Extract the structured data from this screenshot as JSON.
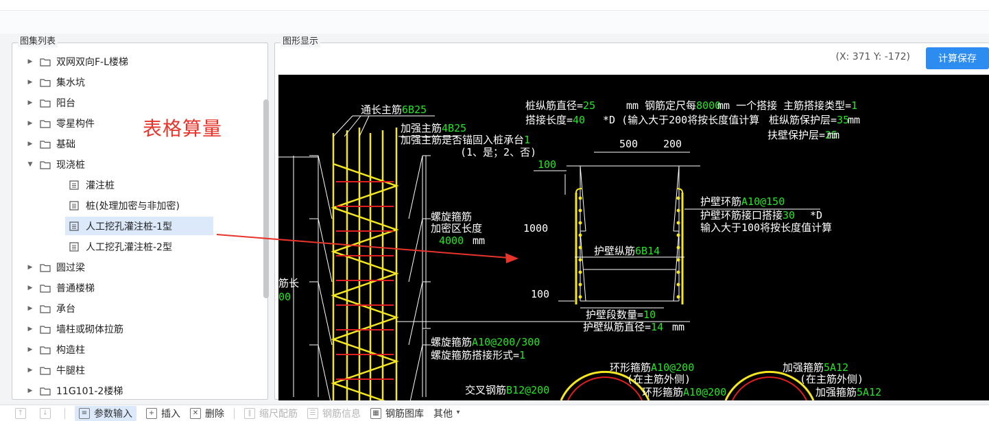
{
  "left_panel": {
    "title": "图集列表",
    "tree": [
      {
        "label": "双网双向F-L楼梯",
        "type": "folder",
        "expanded": false
      },
      {
        "label": "集水坑",
        "type": "folder",
        "expanded": false
      },
      {
        "label": "阳台",
        "type": "folder",
        "expanded": false
      },
      {
        "label": "零星构件",
        "type": "folder",
        "expanded": false
      },
      {
        "label": "基础",
        "type": "folder",
        "expanded": false
      },
      {
        "label": "现浇桩",
        "type": "folder",
        "expanded": true
      },
      {
        "label": "灌注桩",
        "type": "doc"
      },
      {
        "label": "桩(处理加密与非加密)",
        "type": "doc"
      },
      {
        "label": "人工挖孔灌注桩-1型",
        "type": "doc",
        "selected": true
      },
      {
        "label": "人工挖孔灌注桩-2型",
        "type": "doc"
      },
      {
        "label": "圆过梁",
        "type": "folder",
        "expanded": false
      },
      {
        "label": "普通楼梯",
        "type": "folder",
        "expanded": false
      },
      {
        "label": "承台",
        "type": "folder",
        "expanded": false
      },
      {
        "label": "墙柱或砌体拉筋",
        "type": "folder",
        "expanded": false
      },
      {
        "label": "构造柱",
        "type": "folder",
        "expanded": false
      },
      {
        "label": "牛腿柱",
        "type": "folder",
        "expanded": false
      },
      {
        "label": "11G101-2楼梯",
        "type": "folder",
        "expanded": false
      }
    ]
  },
  "annotation": {
    "text": "表格算量",
    "color": "#e8342a"
  },
  "right_panel": {
    "title": "图形显示",
    "coords": "(X: 371 Y: -172)",
    "save_button": "计算保存",
    "cad": {
      "labels": [
        {
          "t": "通长主筋",
          "v": "6B25"
        },
        {
          "t": "加强主筋",
          "v": "4B25"
        },
        {
          "t": "加强主筋是否锚固入桩承台",
          "v": "1"
        },
        {
          "t": "(1、是；2、否)",
          "v": ""
        },
        {
          "t": "螺旋箍筋",
          "v": ""
        },
        {
          "t": "加密区长度",
          "v": ""
        },
        {
          "t": "",
          "v": "4000"
        },
        {
          "t": "mm",
          "v": ""
        },
        {
          "t": "螺旋箍筋",
          "v": "A10@200/300"
        },
        {
          "t": "螺旋箍筋搭接形式=",
          "v": "1"
        },
        {
          "t": "交叉钢筋",
          "v": "B12@200"
        },
        {
          "t": "桩纵筋直径=",
          "v": "25"
        },
        {
          "t": "mm   钢筋定尺每",
          "v": "8000"
        },
        {
          "t": "mm 一个搭接   主筋搭接类型=",
          "v": "1"
        },
        {
          "t": "搭接长度=",
          "v": "40"
        },
        {
          "t": "*D (输入大于200将按长度值计算",
          "v": ""
        },
        {
          "t": "桩纵筋保护层=",
          "v": "35"
        },
        {
          "t": "mm",
          "v": ""
        },
        {
          "t": "扶壁保护层=",
          "v": "25"
        },
        {
          "t": "mm",
          "v": ""
        },
        {
          "t": "500",
          "v": ""
        },
        {
          "t": "200",
          "v": ""
        },
        {
          "t": "",
          "v": "100"
        },
        {
          "t": "1000",
          "v": ""
        },
        {
          "t": "100",
          "v": ""
        },
        {
          "t": "护壁环筋",
          "v": "A10@150"
        },
        {
          "t": "护壁环筋接口搭接",
          "v": "30"
        },
        {
          "t": "*D",
          "v": ""
        },
        {
          "t": "输入大于100将按长度值计算",
          "v": ""
        },
        {
          "t": "护壁纵筋",
          "v": "6B14"
        },
        {
          "t": "护壁段数量=",
          "v": "10"
        },
        {
          "t": "护壁纵筋直径=",
          "v": "14"
        },
        {
          "t": "mm",
          "v": ""
        },
        {
          "t": "环形箍筋",
          "v": "A10@200"
        },
        {
          "t": "(在主筋外侧)",
          "v": ""
        },
        {
          "t": "环形箍筋",
          "v": "A10@200"
        },
        {
          "t": "加强箍筋",
          "v": "5A12"
        },
        {
          "t": "(在主筋外侧)",
          "v": ""
        },
        {
          "t": "加强箍筋",
          "v": "5A12"
        },
        {
          "t": "筋长",
          "v": ""
        },
        {
          "t": "",
          "v": "00"
        }
      ]
    }
  },
  "toolbar": {
    "items": [
      {
        "label": "",
        "icon": "nav-up-icon",
        "state": "disabled"
      },
      {
        "label": "",
        "icon": "nav-down-icon",
        "state": "disabled"
      },
      {
        "label": "参数输入",
        "icon": "param-input-icon",
        "state": "active"
      },
      {
        "label": "插入",
        "icon": "insert-icon",
        "state": "normal"
      },
      {
        "label": "删除",
        "icon": "delete-icon",
        "state": "normal"
      },
      {
        "label": "缩尺配筋",
        "icon": "scale-rebar-icon",
        "state": "disabled"
      },
      {
        "label": "钢筋信息",
        "icon": "rebar-info-icon",
        "state": "disabled"
      },
      {
        "label": "钢筋图库",
        "icon": "rebar-library-icon",
        "state": "normal"
      },
      {
        "label": "其他",
        "icon": "chevron-down-icon",
        "state": "normal"
      }
    ]
  },
  "colors": {
    "accent": "#2d8cf0",
    "selection": "#dbe9fb",
    "cad_green": "#22e622",
    "cad_yellow": "#f5e61e",
    "cad_red": "#e02020"
  }
}
